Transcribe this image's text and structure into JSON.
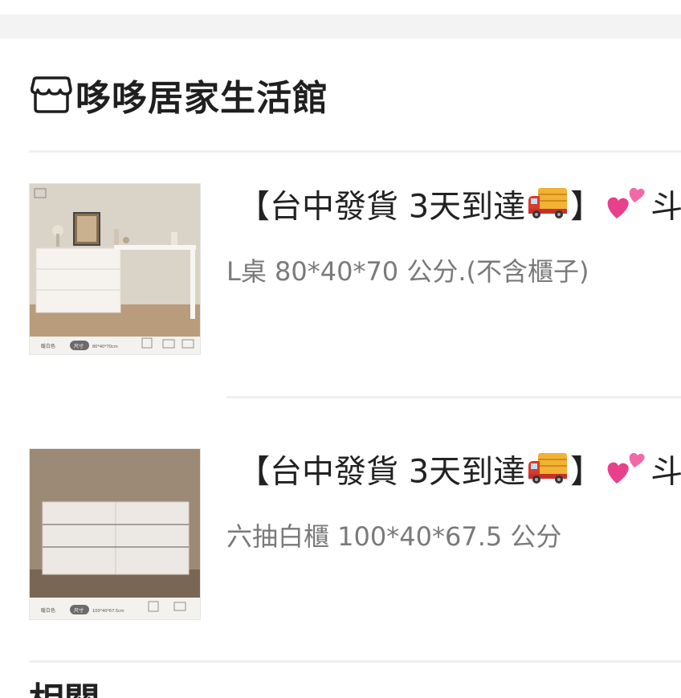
{
  "shop": {
    "name": "哆哆居家生活館",
    "icon": "store-icon"
  },
  "items": [
    {
      "title_prefix": "【台中發貨 3天到達",
      "title_mid": "】",
      "title_suffix": "斗",
      "variant": "L桌 80*40*70 公分.(不含櫃子)",
      "thumb": {
        "color_label": "暖白色",
        "size_badge": "尺寸",
        "size_text": "80*40*70cm"
      }
    },
    {
      "title_prefix": "【台中發貨 3天到達",
      "title_mid": "】",
      "title_suffix": "斗",
      "variant": "六抽白櫃 100*40*67.5 公分",
      "thumb": {
        "color_label": "暖白色",
        "size_badge": "尺寸",
        "size_text": "100*40*67.5cm"
      }
    }
  ],
  "next_section": {
    "label_cut": "相關"
  },
  "colors": {
    "band": "#f3f3f3",
    "divider": "#f0f0f0",
    "variant_text": "#7a7a7a",
    "title_text": "#222222"
  }
}
